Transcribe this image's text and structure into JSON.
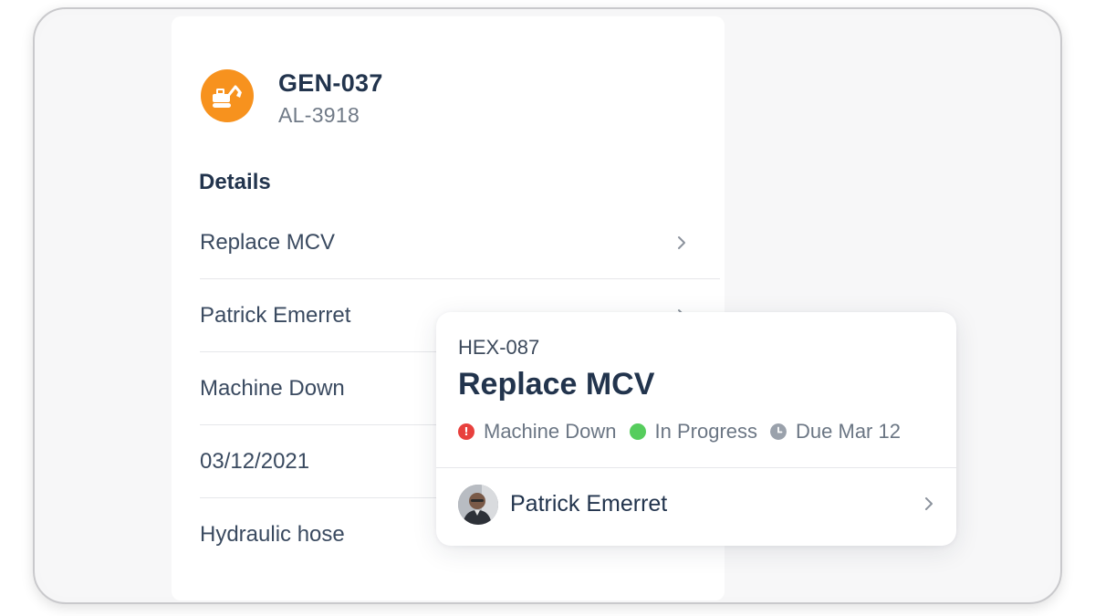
{
  "asset": {
    "icon": "excavator-icon",
    "icon_color": "#f7921e",
    "title": "GEN-037",
    "subtitle": "AL-3918"
  },
  "details": {
    "heading": "Details",
    "rows": [
      {
        "label": "Replace MCV",
        "has_chevron": true
      },
      {
        "label": "Patrick Emerret",
        "has_chevron": true
      },
      {
        "label": "Machine Down",
        "has_chevron": false
      },
      {
        "label": "03/12/2021",
        "has_chevron": false
      },
      {
        "label": "Hydraulic hose",
        "has_chevron": false
      }
    ]
  },
  "work_order": {
    "id": "HEX-087",
    "title": "Replace MCV",
    "statuses": [
      {
        "label": "Machine Down",
        "icon": "alert-icon",
        "color": "#e8403d"
      },
      {
        "label": "In Progress",
        "icon": "status-dot-icon",
        "color": "#56cd5d"
      },
      {
        "label": "Due Mar 12",
        "icon": "clock-icon",
        "color": "#9aa1ab"
      }
    ],
    "assignee": {
      "name": "Patrick Emerret",
      "avatar": "avatar"
    }
  }
}
